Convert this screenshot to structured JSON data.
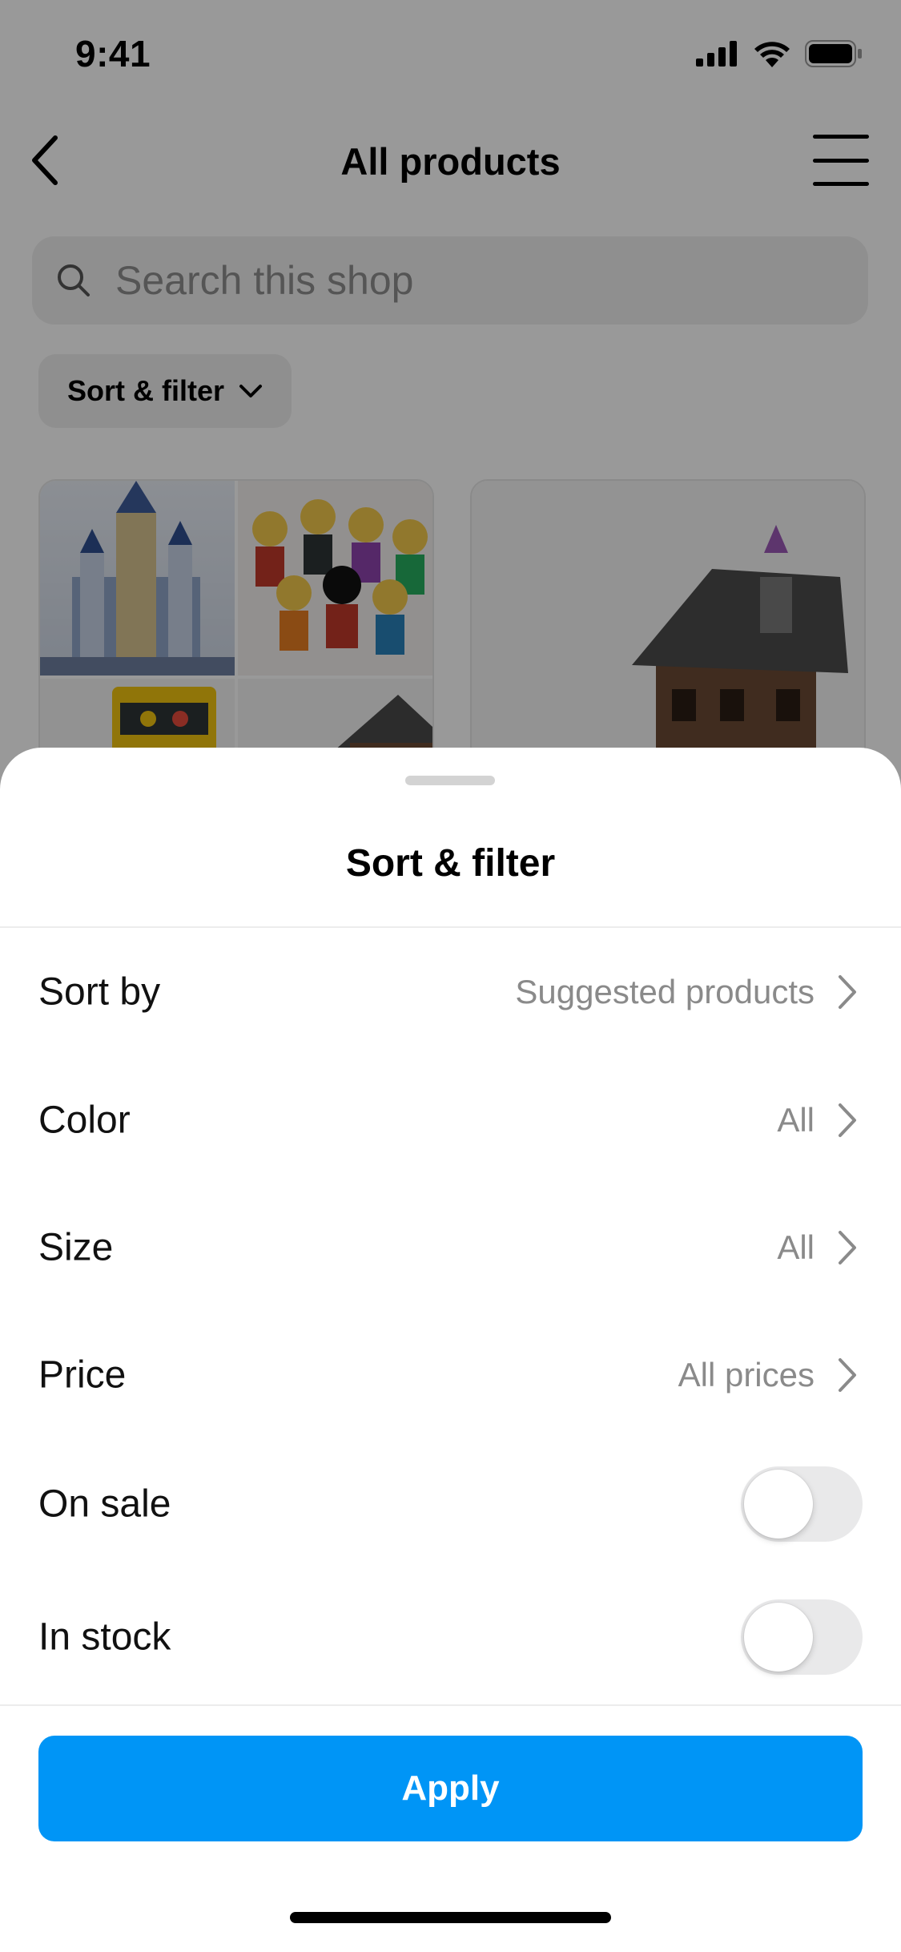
{
  "status_bar": {
    "time": "9:41",
    "icons": [
      "signal-icon",
      "wifi-icon",
      "battery-icon"
    ]
  },
  "nav": {
    "title": "All products",
    "back_icon": "chevron-left-icon",
    "menu_icon": "hamburger-menu-icon"
  },
  "search": {
    "placeholder": "Search this shop",
    "icon": "search-icon"
  },
  "sort_chip": {
    "label": "Sort & filter",
    "icon": "chevron-down-icon"
  },
  "sheet": {
    "title": "Sort & filter",
    "rows": [
      {
        "label": "Sort by",
        "value": "Suggested products",
        "type": "link"
      },
      {
        "label": "Color",
        "value": "All",
        "type": "link"
      },
      {
        "label": "Size",
        "value": "All",
        "type": "link"
      },
      {
        "label": "Price",
        "value": "All prices",
        "type": "link"
      },
      {
        "label": "On sale",
        "on": false,
        "type": "toggle"
      },
      {
        "label": "In stock",
        "on": false,
        "type": "toggle"
      }
    ],
    "apply_label": "Apply"
  },
  "colors": {
    "accent": "#0095f6",
    "muted_text": "#8a8a8a",
    "toggle_off": "#e9e9ea"
  }
}
